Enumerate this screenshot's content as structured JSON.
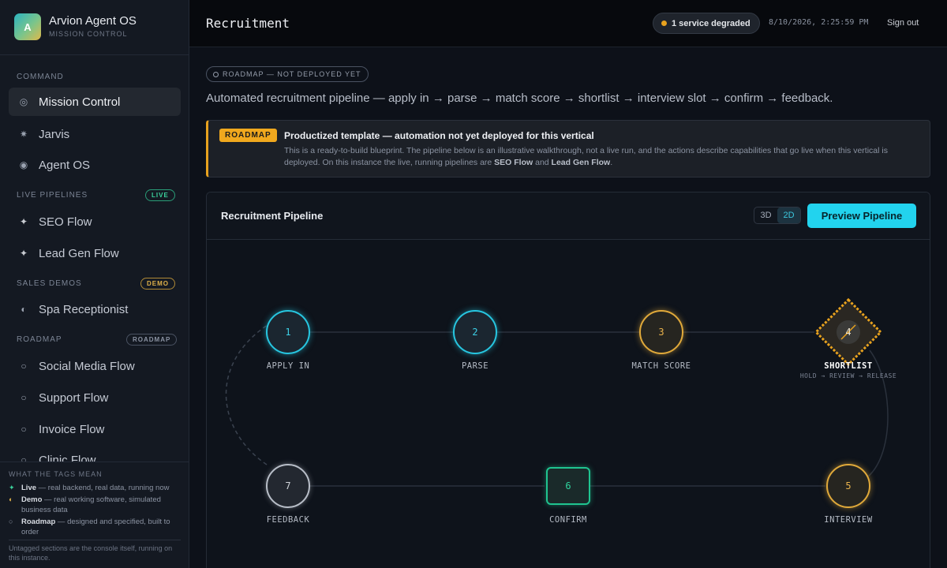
{
  "brand": {
    "logo_letter": "A",
    "title": "Arvion Agent OS",
    "subtitle": "MISSION CONTROL"
  },
  "sidebar": {
    "sections": [
      {
        "label": "COMMAND",
        "badge": ""
      },
      {
        "label": "LIVE PIPELINES",
        "badge": "LIVE"
      },
      {
        "label": "SALES DEMOS",
        "badge": "DEMO"
      },
      {
        "label": "ROADMAP",
        "badge": "ROADMAP"
      }
    ],
    "items": [
      {
        "label": "Mission Control",
        "icon": "target-icon",
        "glyph": "◎",
        "active": true
      },
      {
        "label": "Jarvis",
        "icon": "sparkle-icon",
        "glyph": "✷"
      },
      {
        "label": "Agent OS",
        "icon": "radio-icon",
        "glyph": "◉"
      },
      {
        "label": "SEO Flow",
        "icon": "star-icon",
        "glyph": "✦"
      },
      {
        "label": "Lead Gen Flow",
        "icon": "star-icon",
        "glyph": "✦"
      },
      {
        "label": "Spa Receptionist",
        "icon": "half-circle-icon",
        "glyph": "◐"
      },
      {
        "label": "Social Media Flow",
        "icon": "ring-icon",
        "glyph": "○"
      },
      {
        "label": "Support Flow",
        "icon": "ring-icon",
        "glyph": "○"
      },
      {
        "label": "Invoice Flow",
        "icon": "ring-icon",
        "glyph": "○"
      },
      {
        "label": "Clinic Flow",
        "icon": "ring-icon",
        "glyph": "○"
      }
    ]
  },
  "legend": {
    "title": "WHAT THE TAGS MEAN",
    "rows": [
      {
        "glyph": "✦",
        "name": "Live",
        "desc": " — real backend, real data, running now"
      },
      {
        "glyph": "◐",
        "name": "Demo",
        "desc": " — real working software, simulated business data"
      },
      {
        "glyph": "○",
        "name": "Roadmap",
        "desc": " — designed and specified, built to order"
      }
    ],
    "footer": "Untagged sections are the console itself, running on this instance."
  },
  "header": {
    "title": "Recruitment",
    "status": "1 service degraded",
    "clock": "8/10/2026, 2:25:59 PM",
    "signout": "Sign out"
  },
  "main": {
    "chip": "ROADMAP — NOT DEPLOYED YET",
    "subtitle": "Automated recruitment pipeline — apply in → parse → match score → shortlist → interview slot → confirm → feedback.",
    "notice": {
      "tag": "ROADMAP",
      "title": "Productized template — automation not yet deployed for this vertical",
      "body_pre": "This is a ready-to-build blueprint. The pipeline below is an illustrative walkthrough, not a live run, and the actions describe capabilities that go live when this vertical is deployed. On this instance the live, running pipelines are ",
      "link1": "SEO Flow",
      "and": " and ",
      "link2": "Lead Gen Flow",
      "end": "."
    },
    "panel": {
      "title": "Recruitment Pipeline",
      "toggle": [
        "3D",
        "2D"
      ],
      "button": "Preview Pipeline"
    },
    "pipeline": [
      {
        "step": "1",
        "label": "APPLY IN",
        "state": "done"
      },
      {
        "step": "2",
        "label": "PARSE",
        "state": "done"
      },
      {
        "step": "3",
        "label": "MATCH SCORE",
        "state": "pending"
      },
      {
        "step": "4",
        "label": "SHORTLIST",
        "sublabel": "HOLD → REVIEW → RELEASE",
        "state": "gate"
      },
      {
        "step": "5",
        "label": "INTERVIEW",
        "state": "pending"
      },
      {
        "step": "6",
        "label": "CONFIRM",
        "state": "confirm"
      },
      {
        "step": "7",
        "label": "FEEDBACK",
        "state": "final"
      }
    ]
  },
  "colors": {
    "accent": "#22d3ee",
    "warning": "#e8a21e",
    "success": "#1fc490"
  }
}
